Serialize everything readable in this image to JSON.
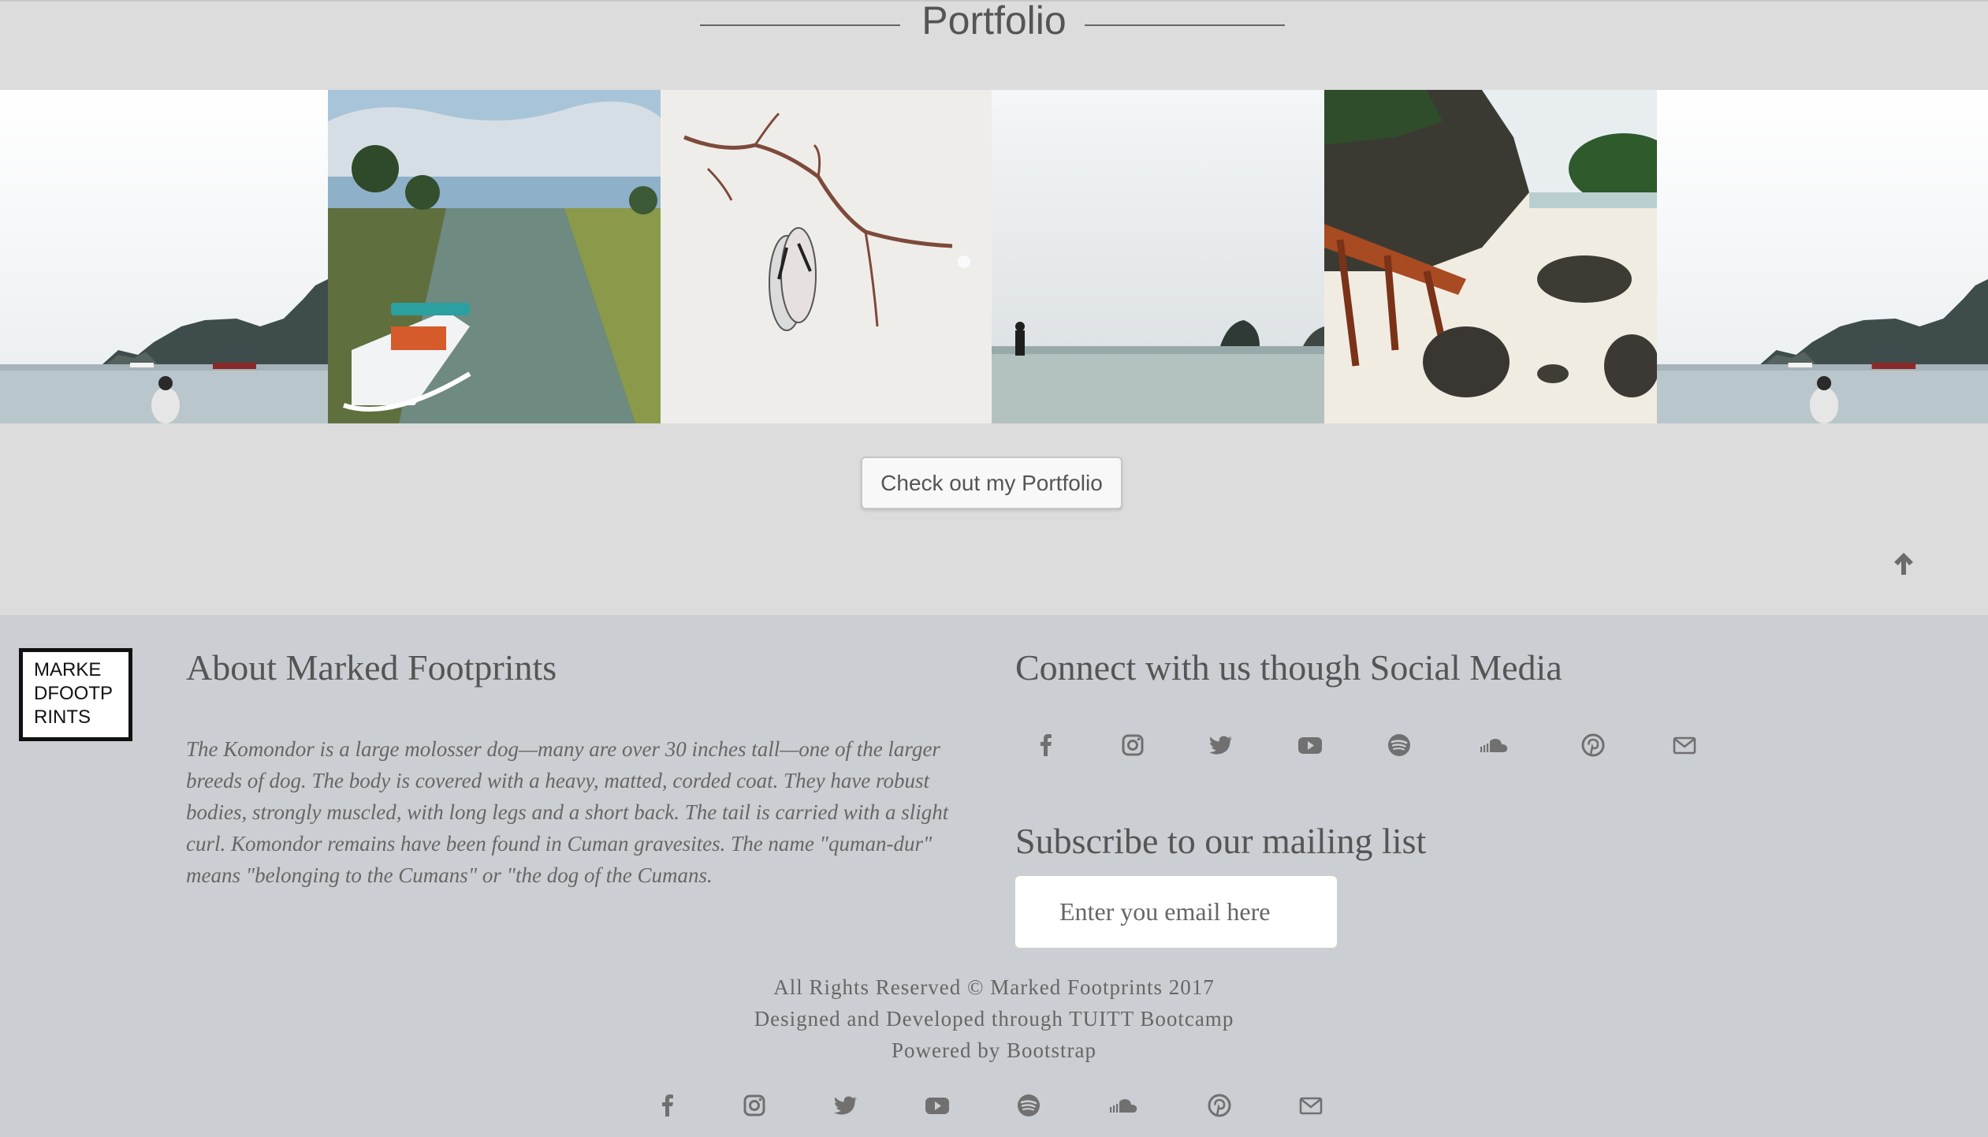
{
  "portfolio": {
    "title": "Portfolio",
    "button_label": "Check out my Portfolio",
    "photos": [
      {
        "name": "photo-person-watching-sea-islands",
        "icon": "photo"
      },
      {
        "name": "photo-boat-on-river",
        "icon": "photo"
      },
      {
        "name": "photo-flip-flops-and-branch-on-sand",
        "icon": "photo"
      },
      {
        "name": "photo-person-wading-in-sea",
        "icon": "photo"
      },
      {
        "name": "photo-rocky-beach-with-wreck",
        "icon": "photo"
      },
      {
        "name": "photo-person-watching-sea-islands-repeat",
        "icon": "photo"
      }
    ],
    "back_to_top_icon": "arrow-up-icon"
  },
  "footer": {
    "logo_text": "MARKE\nDFOOTP\nRINTS",
    "about": {
      "heading": "About Marked Footprints",
      "text": "The Komondor is a large molosser dog—many are over 30 inches tall—one of the larger breeds of dog. The body is covered with a heavy, matted, corded coat. They have robust bodies, strongly muscled, with long legs and a short back. The tail is carried with a slight curl. Komondor remains have been found in Cuman gravesites. The name \"quman-dur\" means \"belonging to the Cumans\" or \"the dog of the Cumans."
    },
    "social": {
      "heading": "Connect with us though Social Media",
      "icons": [
        "facebook-icon",
        "instagram-icon",
        "twitter-icon",
        "youtube-icon",
        "spotify-icon",
        "soundcloud-icon",
        "pinterest-icon",
        "envelope-icon"
      ]
    },
    "subscribe": {
      "heading": "Subscribe to our mailing list",
      "placeholder": "Enter you email here"
    },
    "credits": {
      "line1": "All Rights Reserved © Marked Footprints 2017",
      "line2": "Designed and Developed through TUITT Bootcamp",
      "line3": "Powered by Bootstrap"
    }
  },
  "colors": {
    "section_bg": "#dcdcdc",
    "footer_bg": "#cbcfd3",
    "text_gray": "#666666",
    "heading_gray": "#555555"
  }
}
